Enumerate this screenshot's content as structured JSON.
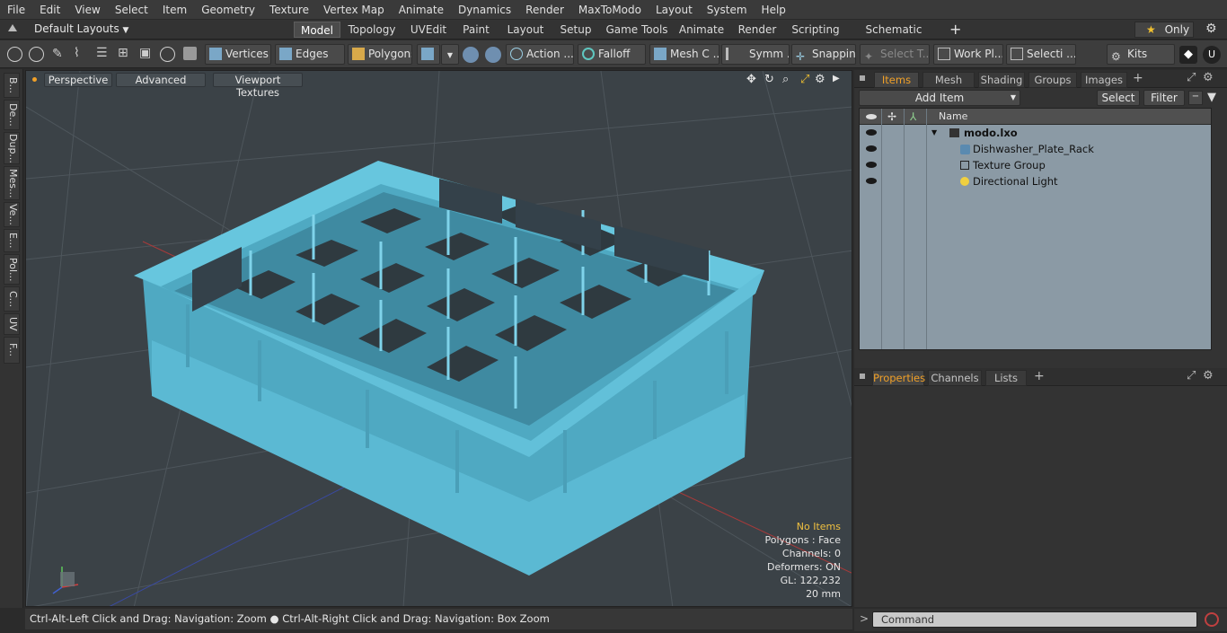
{
  "menu": [
    "File",
    "Edit",
    "View",
    "Select",
    "Item",
    "Geometry",
    "Texture",
    "Vertex Map",
    "Animate",
    "Dynamics",
    "Render",
    "MaxToModo",
    "Layout",
    "System",
    "Help"
  ],
  "layout_selector": "Default Layouts",
  "layout_tabs": [
    "Model",
    "Topology",
    "UVEdit",
    "Paint",
    "Layout",
    "Setup",
    "Game Tools",
    "Animate",
    "Render",
    "Scripting",
    "Schematic Fusion"
  ],
  "active_layout_tab": "Model",
  "only_label": "Only",
  "toolbar": {
    "vertices": "Vertices",
    "edges": "Edges",
    "polygons": "Polygons",
    "action": "Action ...",
    "falloff": "Falloff",
    "mesh": "Mesh C ...",
    "symm": "Symm ...",
    "snapping": "Snapping",
    "select_t": "Select T...",
    "work_pl": "Work Pl...",
    "selecti": "Selecti ...",
    "kits": "Kits"
  },
  "left_tabs": [
    "B...",
    "De...",
    "Dup...",
    "Mes...",
    "Ve...",
    "E...",
    "Pol...",
    "C...",
    "UV",
    "F..."
  ],
  "viewport": {
    "buttons": [
      "Perspective",
      "Advanced",
      "Viewport Textures"
    ],
    "info": {
      "no_items": "No Items",
      "polygons": "Polygons : Face",
      "channels": "Channels: 0",
      "deformers": "Deformers: ON",
      "gl": "GL: 122,232",
      "units": "20 mm"
    }
  },
  "right_panel": {
    "top_tabs": [
      "Items",
      "Mesh Ops",
      "Shading",
      "Groups",
      "Images"
    ],
    "add_item": "Add Item",
    "select": "Select",
    "filter": "Filter",
    "name_header": "Name",
    "items": [
      {
        "label": "modo.lxo",
        "bold": true
      },
      {
        "label": "Dishwasher_Plate_Rack",
        "bold": false
      },
      {
        "label": "Texture Group",
        "bold": false
      },
      {
        "label": "Directional Light",
        "bold": false
      }
    ],
    "bottom_tabs": [
      "Properties",
      "Channels",
      "Lists"
    ]
  },
  "status_bar": "Ctrl-Alt-Left Click and Drag: Navigation: Zoom ● Ctrl-Alt-Right Click and Drag: Navigation: Box Zoom",
  "command_placeholder": "Command",
  "colors": {
    "model": "#5ab8d2",
    "viewport_bg": "#3b4247",
    "accent": "#f0a028"
  }
}
